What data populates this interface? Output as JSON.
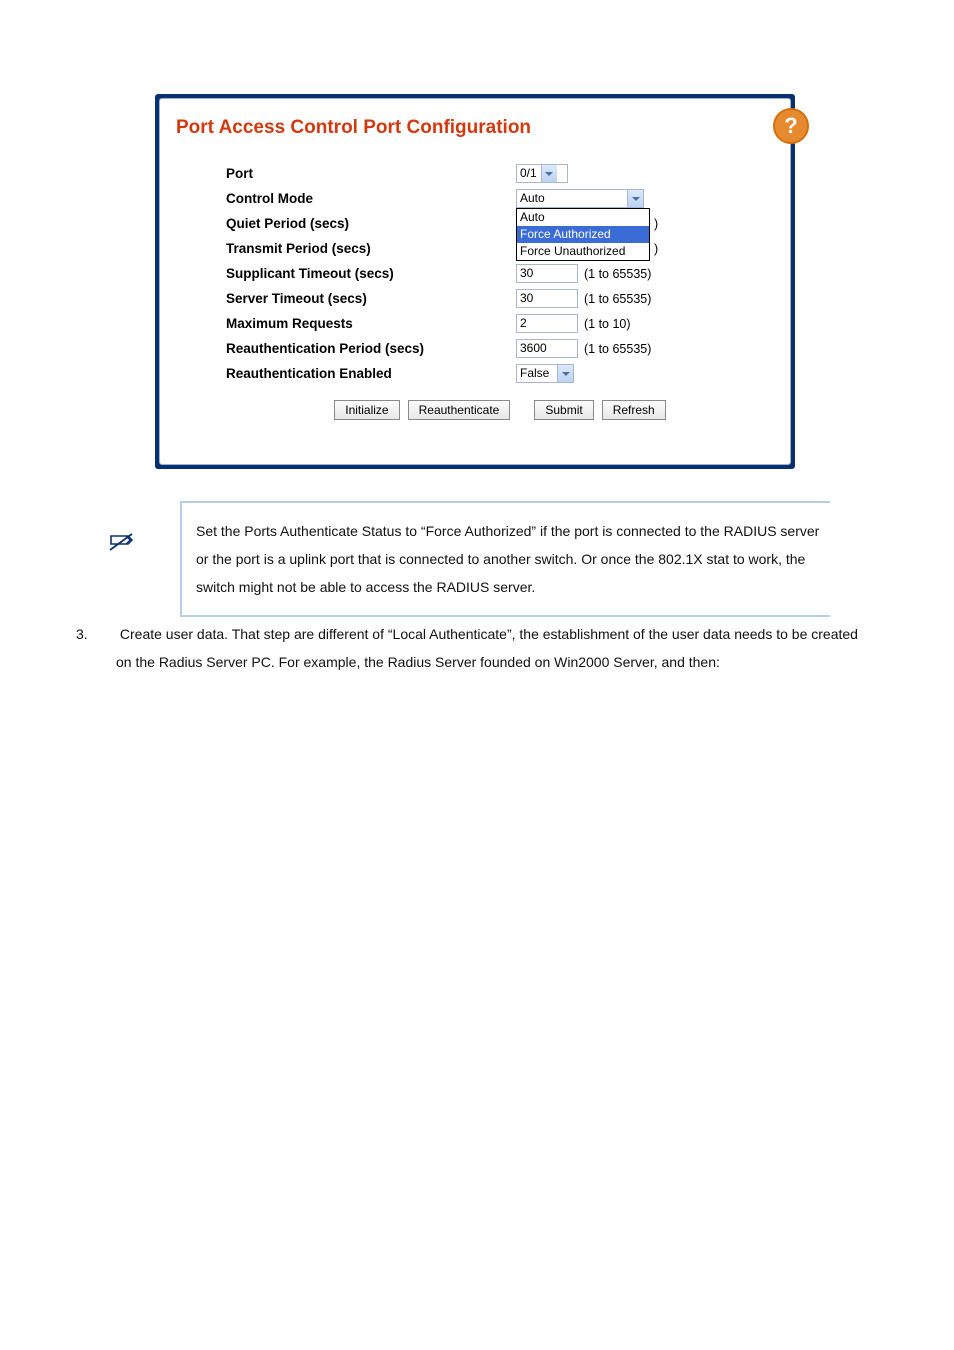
{
  "panel": {
    "title": "Port Access Control Port Configuration",
    "help_glyph": "?"
  },
  "form": {
    "port": {
      "label": "Port",
      "value": "0/1"
    },
    "control_mode": {
      "label": "Control Mode",
      "value": "Auto",
      "options": [
        "Auto",
        "Force Authorized",
        "Force Unauthorized"
      ],
      "selected_index": 1
    },
    "quiet_period": {
      "label": "Quiet Period (secs)",
      "hint": ")"
    },
    "transmit_period": {
      "label": "Transmit Period (secs)",
      "hint": ")"
    },
    "supplicant_timeout": {
      "label": "Supplicant Timeout (secs)",
      "value": "30",
      "hint": "(1 to 65535)"
    },
    "server_timeout": {
      "label": "Server Timeout (secs)",
      "value": "30",
      "hint": "(1 to 65535)"
    },
    "max_requests": {
      "label": "Maximum Requests",
      "value": "2",
      "hint": "(1 to 10)"
    },
    "reauth_period": {
      "label": "Reauthentication Period (secs)",
      "value": "3600",
      "hint": "(1 to 65535)"
    },
    "reauth_enabled": {
      "label": "Reauthentication Enabled",
      "value": "False"
    }
  },
  "buttons": {
    "initialize": "Initialize",
    "reauthenticate": "Reauthenticate",
    "submit": "Submit",
    "refresh": "Refresh"
  },
  "note": "Set the Ports Authenticate Status to “Force Authorized” if the port is connected to the RADIUS server or the port is a uplink port that is connected to another switch. Or once the 802.1X stat to work, the switch might not be able to access the RADIUS server.",
  "step": {
    "number": "3.",
    "text": "Create user data. That step are different of “Local Authenticate”, the establishment of the user data needs to be created on the Radius Server PC. For example, the Radius Server founded on Win2000 Server, and then:"
  }
}
